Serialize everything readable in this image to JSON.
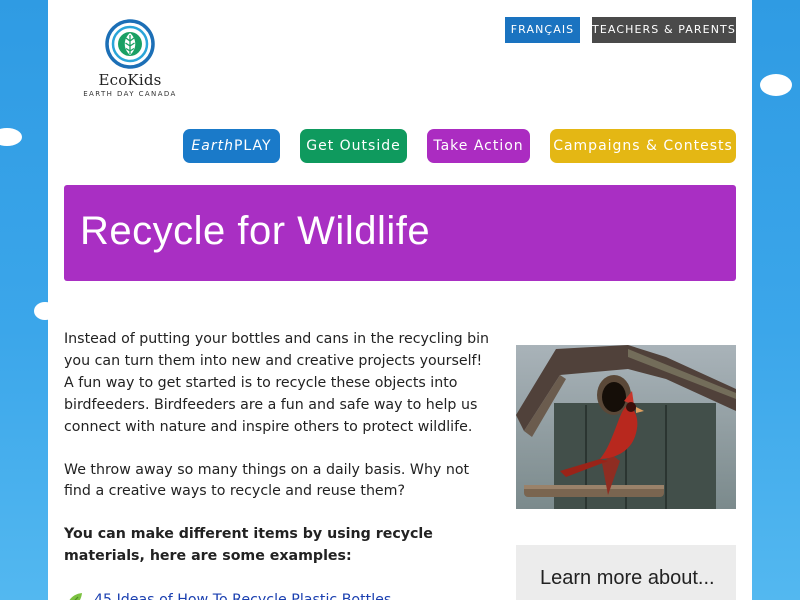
{
  "logo": {
    "name": "EcoKids",
    "sub": "EARTH DAY CANADA"
  },
  "top_buttons": {
    "francais": "FRANÇAIS",
    "teachers": "TEACHERS & PARENTS"
  },
  "nav": {
    "earth_italic": "Earth",
    "earth_rest": "PLAY",
    "get_outside": "Get Outside",
    "take_action": "Take Action",
    "campaigns": "Campaigns & Contests"
  },
  "banner": {
    "title": "Recycle for Wildlife"
  },
  "content": {
    "para1": "Instead of putting your bottles and cans in the recycling bin you can turn them into new and creative projects yourself! A fun way to get started is to recycle these objects into birdfeeders. Birdfeeders are a fun and safe way to help us connect with nature and inspire others to protect wildlife.",
    "para2": "We throw away so many things on a daily basis. Why not find a creative ways to recycle and reuse them?",
    "bold": "You can make different items by using recycle materials, here are some examples:",
    "list": [
      {
        "link": "45 Ideas of How To Recycle Plastic Bottles"
      }
    ]
  },
  "sidebar": {
    "learn_more": "Learn more about..."
  },
  "colors": {
    "sky": "#3ba6ea",
    "francais": "#1a73c0",
    "teachers": "#4a4a4a",
    "earthplay": "#1a7ac9",
    "get_outside": "#0f9a5e",
    "take_action": "#ab2cc1",
    "campaigns": "#e4b714",
    "banner": "#a92fc3"
  }
}
